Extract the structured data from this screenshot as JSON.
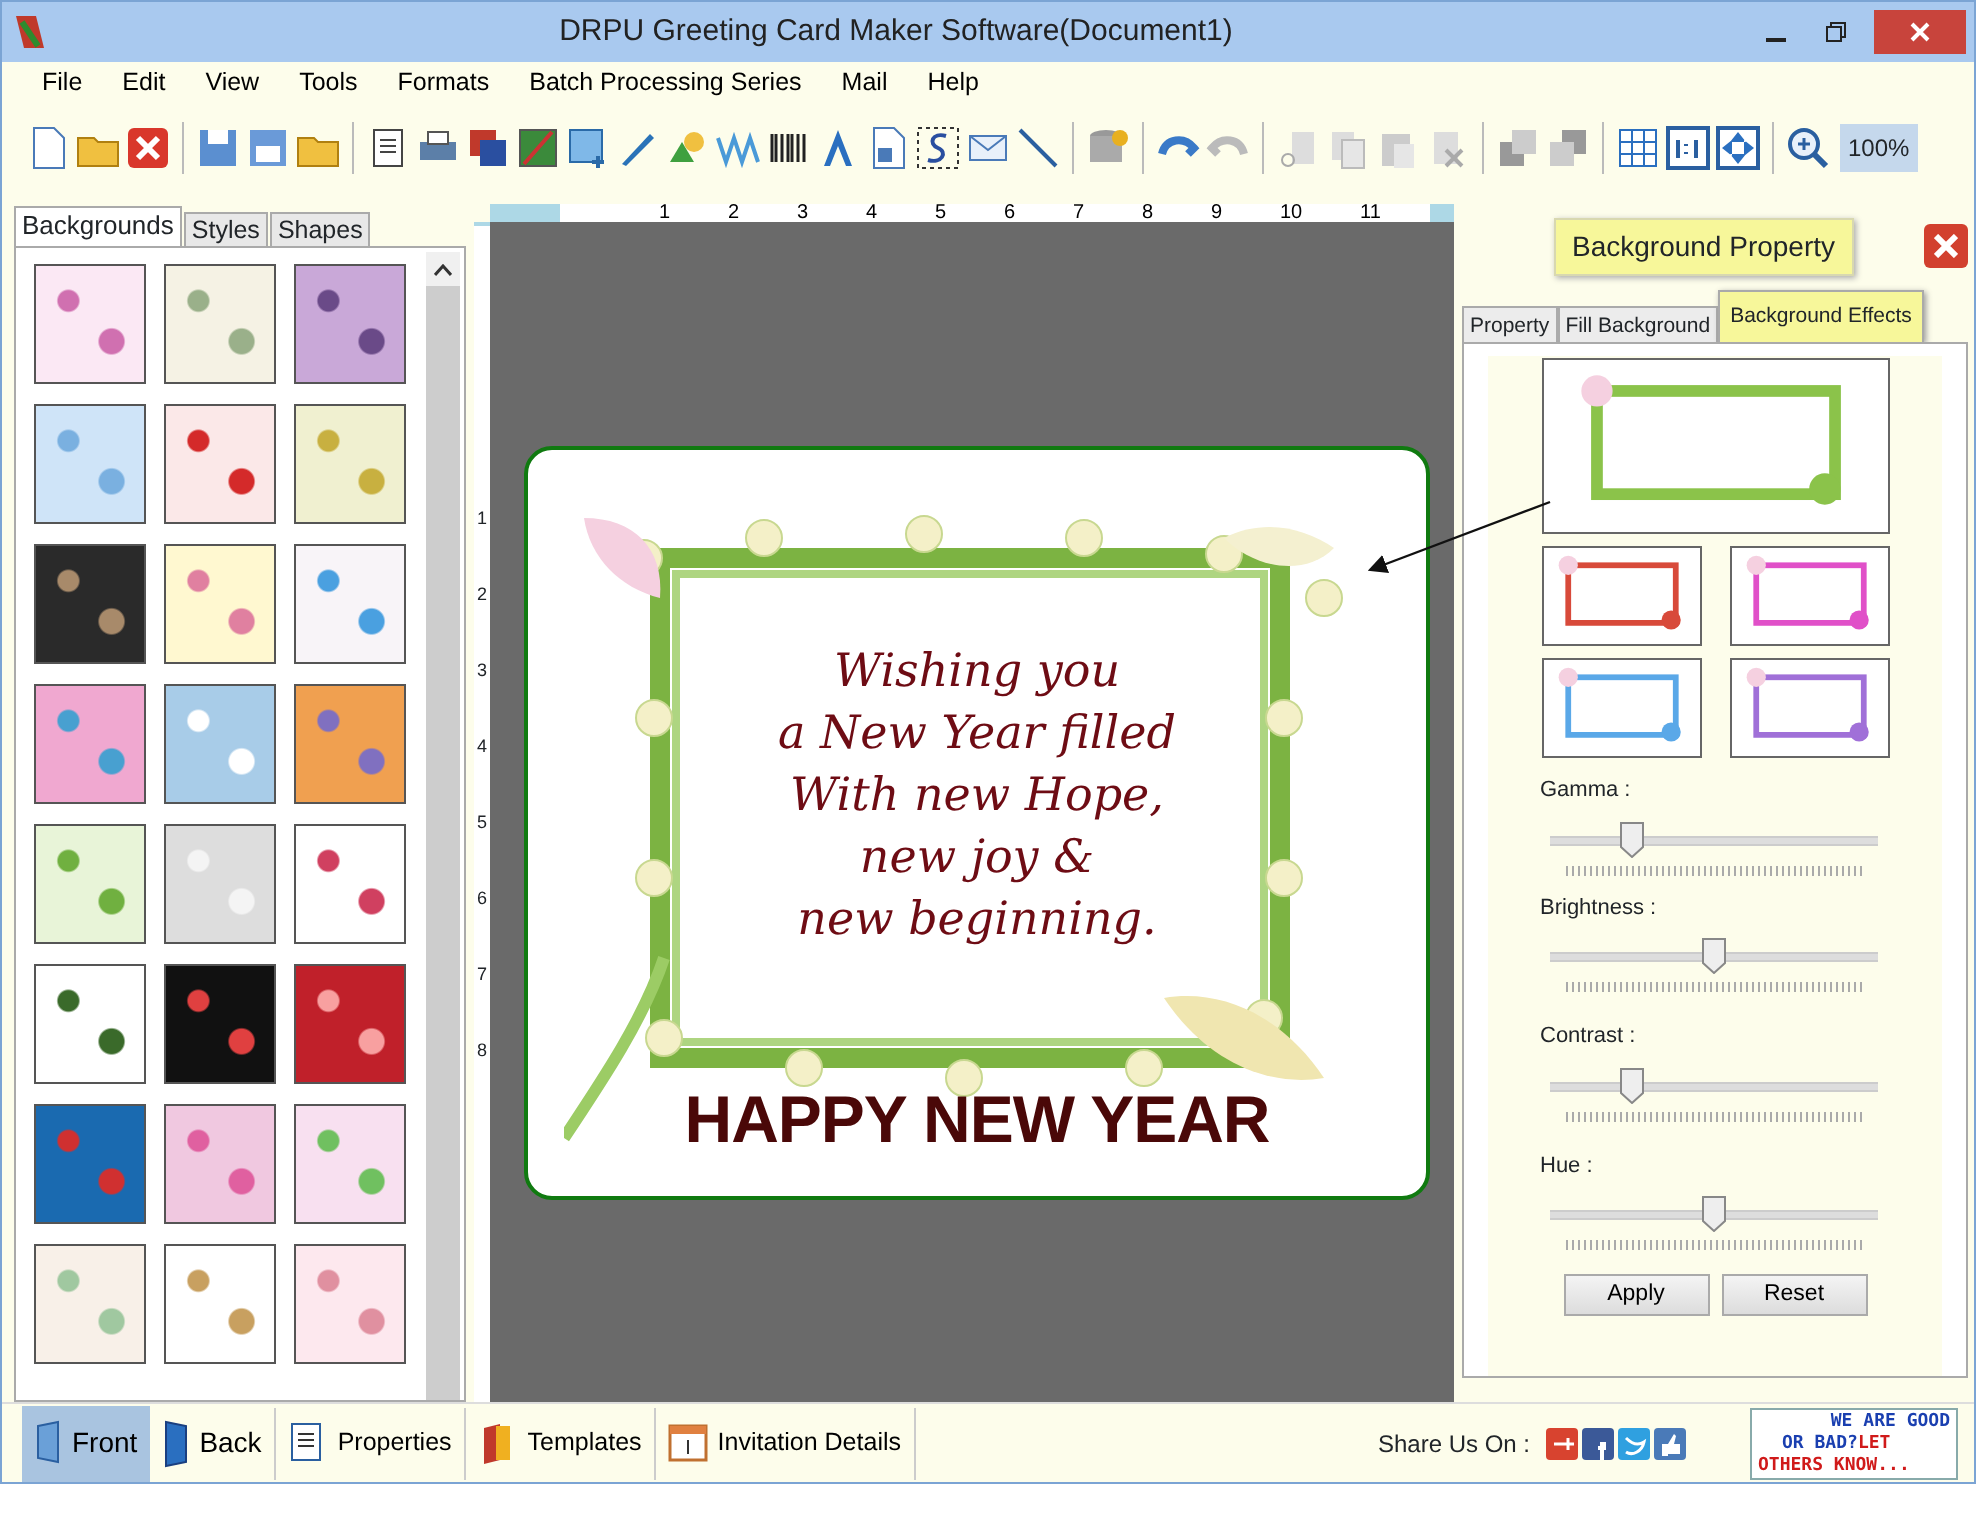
{
  "window": {
    "title": "DRPU Greeting Card Maker Software(Document1)"
  },
  "menu": [
    "File",
    "Edit",
    "View",
    "Tools",
    "Formats",
    "Batch Processing Series",
    "Mail",
    "Help"
  ],
  "toolbar": {
    "zoom": "100%"
  },
  "left_panel": {
    "tabs": [
      {
        "label": "Backgrounds",
        "selected": true
      },
      {
        "label": "Styles",
        "selected": false
      },
      {
        "label": "Shapes",
        "selected": false
      }
    ]
  },
  "rulers": {
    "horizontal": [
      "1",
      "2",
      "3",
      "4",
      "5",
      "6",
      "7",
      "8",
      "9",
      "10",
      "11"
    ],
    "vertical": [
      "1",
      "2",
      "3",
      "4",
      "5",
      "6",
      "7",
      "8"
    ]
  },
  "card": {
    "message": [
      "Wishing you",
      "a New Year filled",
      "With new Hope,",
      "new joy &",
      "new beginning."
    ],
    "heading": "HAPPY NEW YEAR"
  },
  "properties_panel": {
    "title": "Background Property",
    "tabs": [
      {
        "label": "Property",
        "selected": false
      },
      {
        "label": "Fill Background",
        "selected": false
      },
      {
        "label": "Background Effects",
        "selected": true
      }
    ],
    "sliders": [
      {
        "label": "Gamma :",
        "level": 0.23
      },
      {
        "label": "Brightness :",
        "level": 0.5
      },
      {
        "label": "Contrast :",
        "level": 0.23
      },
      {
        "label": "Hue :",
        "level": 0.5
      }
    ],
    "buttons": [
      "Apply",
      "Reset"
    ]
  },
  "bottom_bar": {
    "views": [
      {
        "label": "Front",
        "selected": true
      },
      {
        "label": "Back",
        "selected": false
      }
    ],
    "buttons": [
      "Properties",
      "Templates",
      "Invitation Details"
    ],
    "share_label": "Share Us On :",
    "feedback": [
      "WE ARE GOOD",
      "OR BAD?",
      "LET",
      "OTHERS KNOW..."
    ]
  }
}
